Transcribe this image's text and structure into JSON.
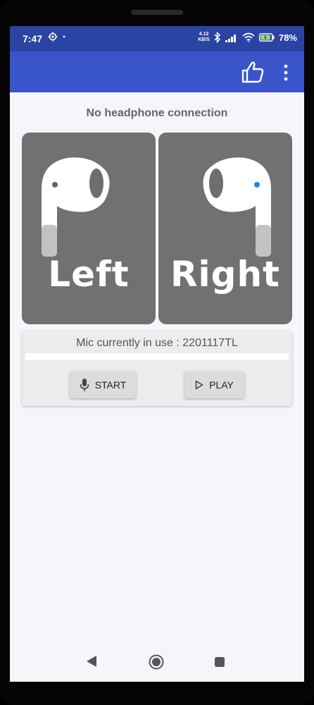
{
  "status_bar": {
    "time": "7:47",
    "net_speed_value": "4.12",
    "net_speed_unit": "KB/S",
    "battery": "78%"
  },
  "app_bar": {
    "like_icon": "thumb-up-icon",
    "menu_icon": "more-vert-icon"
  },
  "content": {
    "connection_status": "No headphone connection",
    "left_label": "Left",
    "right_label": "Right",
    "mic_text": "Mic currently in use : 2201117TL",
    "start_label": "START",
    "play_label": "PLAY"
  },
  "colors": {
    "status_bar": "#2b44a3",
    "app_bar": "#3a55c9",
    "card": "#717171",
    "right_indicator": "#1e88e5"
  },
  "nav": {
    "back_icon": "back-triangle-icon",
    "home_icon": "home-circle-icon",
    "recents_icon": "recents-square-icon"
  }
}
